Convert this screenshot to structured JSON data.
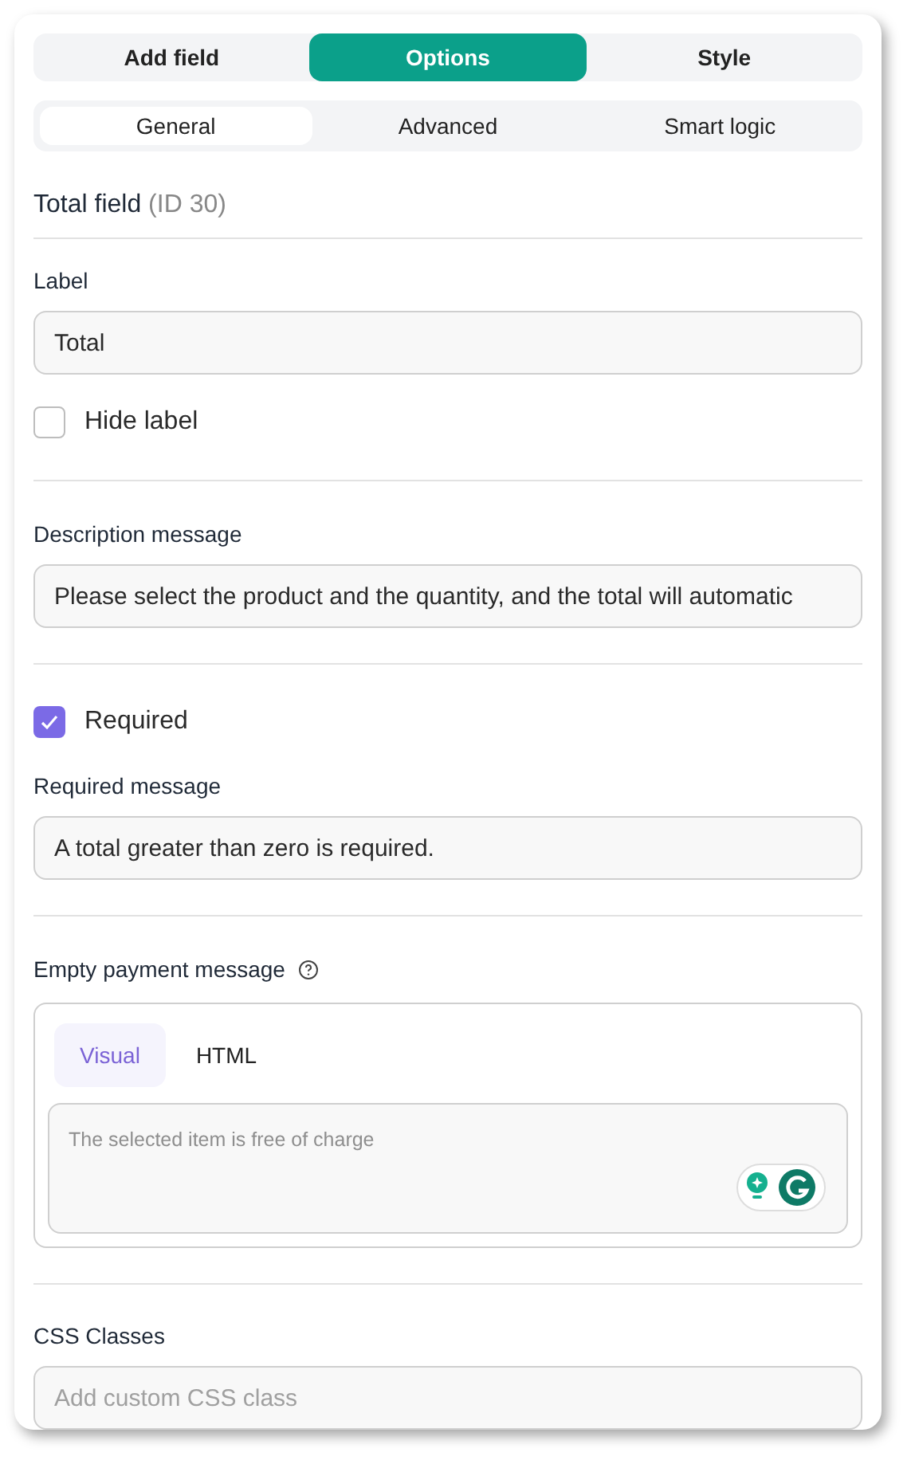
{
  "main_tabs": [
    {
      "label": "Add field",
      "selected": false
    },
    {
      "label": "Options",
      "selected": true
    },
    {
      "label": "Style",
      "selected": false
    }
  ],
  "sub_tabs": [
    {
      "label": "General",
      "selected": true
    },
    {
      "label": "Advanced",
      "selected": false
    },
    {
      "label": "Smart logic",
      "selected": false
    }
  ],
  "heading": {
    "title": "Total field",
    "id": "(ID 30)"
  },
  "label_field": {
    "label": "Label",
    "value": "Total"
  },
  "hide_label": {
    "label": "Hide label",
    "checked": false
  },
  "description": {
    "label": "Description message",
    "value": "Please select the product and the quantity, and the total will automatic"
  },
  "required": {
    "label": "Required",
    "checked": true
  },
  "required_message": {
    "label": "Required message",
    "value": "A total greater than zero is required."
  },
  "empty_payment": {
    "label": "Empty payment message",
    "editor_tabs": [
      {
        "label": "Visual",
        "selected": true
      },
      {
        "label": "HTML",
        "selected": false
      }
    ],
    "placeholder": "The selected item is free of charge"
  },
  "css_classes": {
    "label": "CSS Classes",
    "placeholder": "Add custom CSS class"
  }
}
